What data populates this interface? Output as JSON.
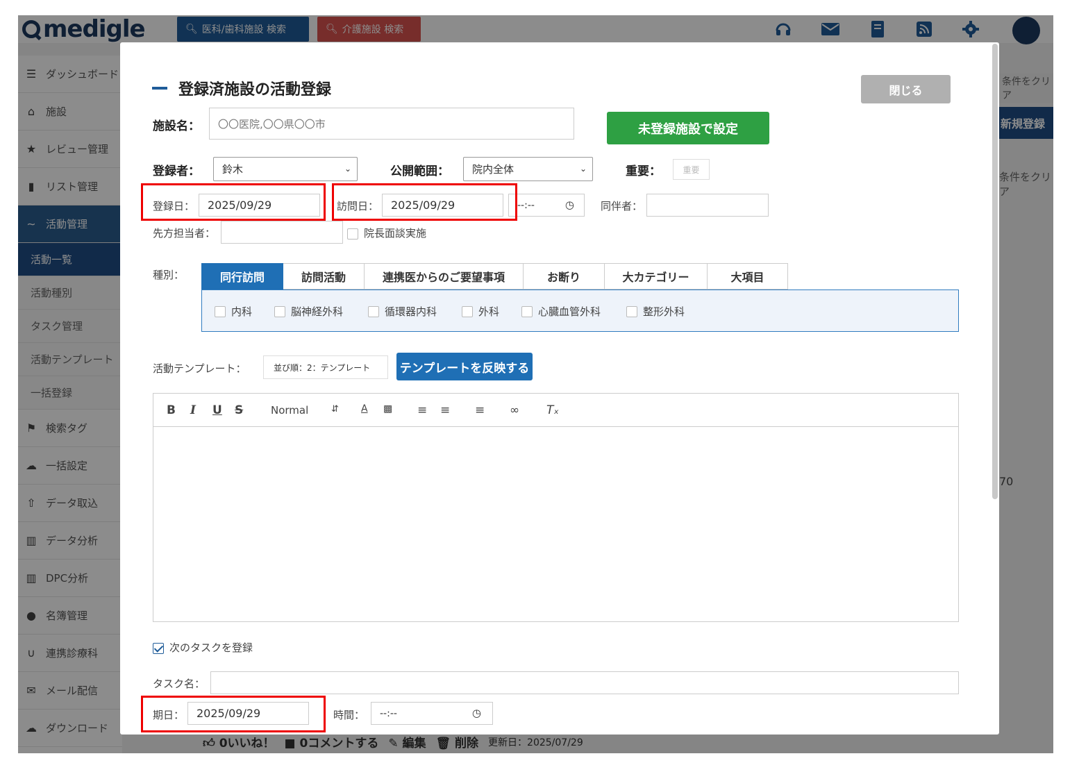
{
  "header": {
    "logo": "medigle",
    "btn_medical": "医科/歯科施設 検索",
    "btn_care": "介護施設 検索"
  },
  "sidebar": {
    "items": [
      {
        "label": "ダッシュボード",
        "icon": "dashboard-icon"
      },
      {
        "label": "施設",
        "icon": "home-icon"
      },
      {
        "label": "レビュー管理",
        "icon": "review-icon"
      },
      {
        "label": "リスト管理",
        "icon": "bookmark-icon"
      },
      {
        "label": "活動管理",
        "icon": "handshake-icon"
      }
    ],
    "subitems": [
      "活動一覧",
      "活動種別",
      "タスク管理",
      "活動テンプレート",
      "一括登録"
    ],
    "items2": [
      {
        "label": "検索タグ",
        "icon": "tag-icon"
      },
      {
        "label": "一括設定",
        "icon": "cloud-icon"
      },
      {
        "label": "データ取込",
        "icon": "file-upload-icon"
      },
      {
        "label": "データ分析",
        "icon": "bar-chart-icon"
      },
      {
        "label": "DPC分析",
        "icon": "bar-chart-icon"
      },
      {
        "label": "名簿管理",
        "icon": "users-icon"
      },
      {
        "label": "連携診療科",
        "icon": "stethoscope-icon"
      },
      {
        "label": "メール配信",
        "icon": "mail-icon"
      },
      {
        "label": "ダウンロード",
        "icon": "cloud-download-icon"
      }
    ]
  },
  "behind": {
    "clear1": "条件をクリア",
    "new": "新規登録",
    "clear2": "条件をクリア",
    "num": "70",
    "likes": "0いいね！",
    "comments": "0コメントする",
    "edit": "編集",
    "delete": "削除",
    "updated": "更新日：2025/07/29"
  },
  "modal": {
    "title": "登録済施設の活動登録",
    "close": "閉じる",
    "facility_label": "施設名：",
    "facility_placeholder": "〇〇医院,〇〇県〇〇市",
    "unregistered_btn": "未登録施設で設定",
    "registrant_label": "登録者：",
    "registrant_value": "鈴木",
    "scope_label": "公開範囲：",
    "scope_value": "院内全体",
    "important_label": "重要：",
    "important_tag": "重要",
    "reg_date_label": "登録日：",
    "reg_date": "2025/09/29",
    "visit_date_label": "訪問日：",
    "visit_date": "2025/09/29",
    "visit_time": "--:--",
    "companion_label": "同伴者：",
    "contact_label": "先方担当者：",
    "director_interview": "院長面談実施",
    "type_label": "種別：",
    "tabs": [
      "同行訪問",
      "訪問活動",
      "連携医からのご要望事項",
      "お断り",
      "大カテゴリー",
      "大項目"
    ],
    "departments": [
      "内科",
      "脳神経外科",
      "循環器内科",
      "外科",
      "心臓血管外科",
      "整形外科"
    ],
    "template_label": "活動テンプレート：",
    "template_value": "並び順：2：テンプレート",
    "apply_template": "テンプレートを反映する",
    "editor_format": "Normal",
    "next_task": "次のタスクを登録",
    "task_name_label": "タスク名：",
    "due_label": "期日：",
    "due_date": "2025/09/29",
    "time_label": "時間：",
    "time_value": "--:--"
  },
  "colors": {
    "brand": "#1c3a60",
    "primary": "#1f6fb5",
    "green": "#2ea043",
    "highlight": "#ee0000"
  }
}
